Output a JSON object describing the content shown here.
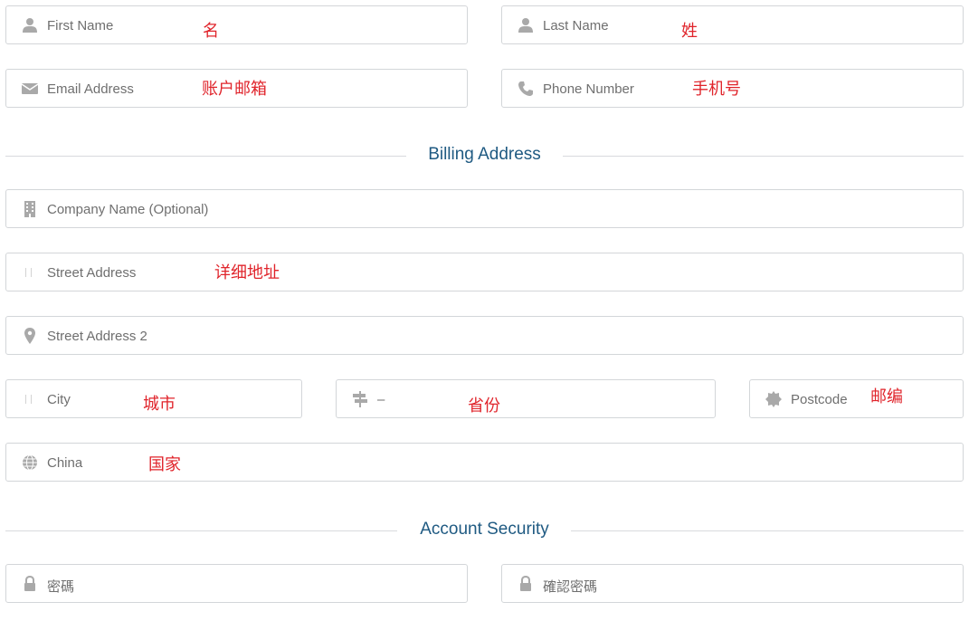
{
  "personal": {
    "first_name_placeholder": "First Name",
    "first_name_note": "名",
    "last_name_placeholder": "Last Name",
    "last_name_note": "姓",
    "email_placeholder": "Email Address",
    "email_note": "账户邮箱",
    "phone_placeholder": "Phone Number",
    "phone_note": "手机号"
  },
  "billing": {
    "section_title": "Billing Address",
    "company_placeholder": "Company Name (Optional)",
    "street_placeholder": "Street Address",
    "street_note": "详细地址",
    "street2_placeholder": "Street Address 2",
    "city_placeholder": "City",
    "city_note": "城市",
    "state_value": "–",
    "state_note": "省份",
    "postcode_placeholder": "Postcode",
    "postcode_note": "邮编",
    "country_value": "China",
    "country_note": "国家"
  },
  "security": {
    "section_title": "Account Security",
    "password_placeholder": "密碼",
    "confirm_password_placeholder": "確認密碼"
  },
  "colors": {
    "icon": "#a9a9a9",
    "placeholder_text": "#6f6f6f",
    "section_title": "#1f5a82",
    "annotation": "#e0242b",
    "border": "#d3d6d9"
  },
  "icons": {
    "first_name": "user-icon",
    "last_name": "user-icon",
    "email": "envelope-icon",
    "phone": "phone-icon",
    "company": "building-icon",
    "street": "map-marker-icon",
    "street2": "map-marker-icon",
    "city": "city-icon",
    "state": "signpost-icon",
    "postcode": "certificate-icon",
    "country": "globe-icon",
    "password": "lock-icon",
    "confirm_password": "lock-icon"
  }
}
